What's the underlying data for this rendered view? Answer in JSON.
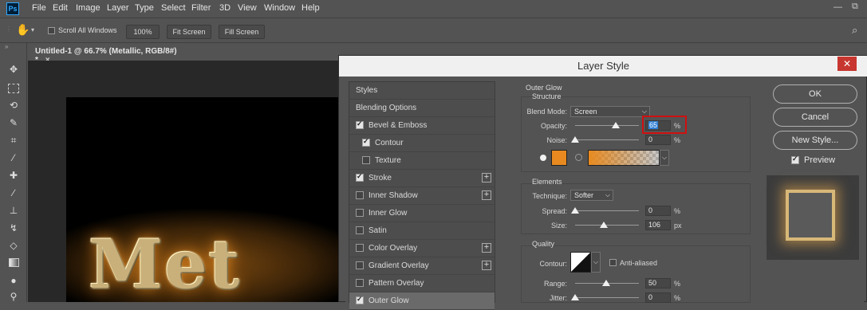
{
  "menubar": {
    "logo": "Ps",
    "items": [
      "File",
      "Edit",
      "Image",
      "Layer",
      "Type",
      "Select",
      "Filter",
      "3D",
      "View",
      "Window",
      "Help"
    ]
  },
  "options_bar": {
    "scroll_all_windows": "Scroll All Windows",
    "zoom_100": "100%",
    "fit_screen": "Fit Screen",
    "fill_screen": "Fill Screen"
  },
  "document": {
    "tab_title": "Untitled-1 @ 66.7% (Metallic, RGB/8#) *",
    "close_glyph": "×",
    "text": "Met"
  },
  "dialog": {
    "title": "Layer Style",
    "close_glyph": "✕",
    "styles": [
      {
        "label": "Styles",
        "checkbox": false,
        "checked": false,
        "plus": false,
        "indent": false
      },
      {
        "label": "Blending Options",
        "checkbox": false,
        "checked": false,
        "plus": false,
        "indent": false
      },
      {
        "label": "Bevel & Emboss",
        "checkbox": true,
        "checked": true,
        "plus": false,
        "indent": false
      },
      {
        "label": "Contour",
        "checkbox": true,
        "checked": true,
        "plus": false,
        "indent": true
      },
      {
        "label": "Texture",
        "checkbox": true,
        "checked": false,
        "plus": false,
        "indent": true
      },
      {
        "label": "Stroke",
        "checkbox": true,
        "checked": true,
        "plus": true,
        "indent": false
      },
      {
        "label": "Inner Shadow",
        "checkbox": true,
        "checked": false,
        "plus": true,
        "indent": false
      },
      {
        "label": "Inner Glow",
        "checkbox": true,
        "checked": false,
        "plus": false,
        "indent": false
      },
      {
        "label": "Satin",
        "checkbox": true,
        "checked": false,
        "plus": false,
        "indent": false
      },
      {
        "label": "Color Overlay",
        "checkbox": true,
        "checked": false,
        "plus": true,
        "indent": false
      },
      {
        "label": "Gradient Overlay",
        "checkbox": true,
        "checked": false,
        "plus": true,
        "indent": false
      },
      {
        "label": "Pattern Overlay",
        "checkbox": true,
        "checked": false,
        "plus": false,
        "indent": false
      },
      {
        "label": "Outer Glow",
        "checkbox": true,
        "checked": true,
        "plus": false,
        "indent": false
      }
    ],
    "outer_glow": {
      "heading": "Outer Glow",
      "structure": "Structure",
      "blend_mode_label": "Blend Mode:",
      "blend_mode_value": "Screen",
      "opacity_label": "Opacity:",
      "opacity_value": "65",
      "opacity_unit": "%",
      "opacity_level": 0.65,
      "noise_label": "Noise:",
      "noise_value": "0",
      "noise_unit": "%",
      "glow_color": "#e88a1f"
    },
    "elements": {
      "heading": "Elements",
      "technique_label": "Technique:",
      "technique_value": "Softer",
      "spread_label": "Spread:",
      "spread_value": "0",
      "spread_unit": "%",
      "size_label": "Size:",
      "size_value": "106",
      "size_unit": "px"
    },
    "quality": {
      "heading": "Quality",
      "contour_label": "Contour:",
      "anti_aliased": "Anti-aliased",
      "range_label": "Range:",
      "range_value": "50",
      "range_unit": "%",
      "jitter_label": "Jitter:",
      "jitter_value": "0",
      "jitter_unit": "%"
    },
    "buttons": {
      "ok": "OK",
      "cancel": "Cancel",
      "new_style": "New Style...",
      "preview": "Preview"
    }
  },
  "colors": {
    "highlight_box": "#d01010",
    "selection": "#2f7fd6",
    "glow": "#e88a1f"
  }
}
